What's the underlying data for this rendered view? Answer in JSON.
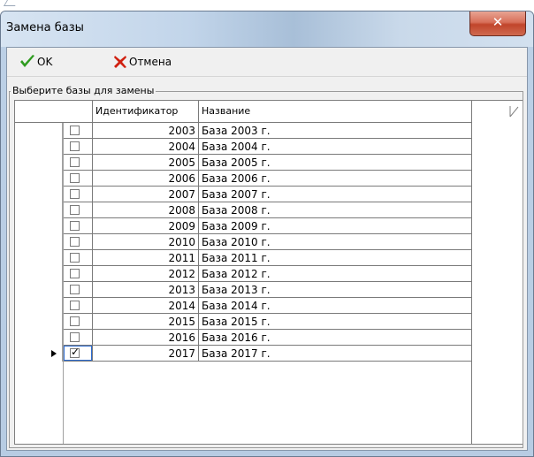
{
  "window": {
    "title": "Замена базы",
    "close_glyph": "✕"
  },
  "toolbar": {
    "ok_label": "OK",
    "cancel_label": "Отмена"
  },
  "group": {
    "label": "Выберите базы для замены"
  },
  "grid": {
    "columns": [
      "Идентификатор",
      "Название"
    ],
    "rows": [
      {
        "id": "2003",
        "name": "База 2003 г.",
        "checked": false
      },
      {
        "id": "2004",
        "name": "База 2004 г.",
        "checked": false
      },
      {
        "id": "2005",
        "name": "База 2005 г.",
        "checked": false
      },
      {
        "id": "2006",
        "name": "База 2006 г.",
        "checked": false
      },
      {
        "id": "2007",
        "name": "База 2007 г.",
        "checked": false
      },
      {
        "id": "2008",
        "name": "База 2008 г.",
        "checked": false
      },
      {
        "id": "2009",
        "name": "База 2009 г.",
        "checked": false
      },
      {
        "id": "2010",
        "name": "База 2010 г.",
        "checked": false
      },
      {
        "id": "2011",
        "name": "База 2011 г.",
        "checked": false
      },
      {
        "id": "2012",
        "name": "База 2012 г.",
        "checked": false
      },
      {
        "id": "2013",
        "name": "База 2013 г.",
        "checked": false
      },
      {
        "id": "2014",
        "name": "База 2014 г.",
        "checked": false
      },
      {
        "id": "2015",
        "name": "База 2015 г.",
        "checked": false
      },
      {
        "id": "2016",
        "name": "База 2016 г.",
        "checked": false
      },
      {
        "id": "2017",
        "name": "База 2017 г.",
        "checked": true,
        "current": true
      }
    ]
  },
  "colors": {
    "ok_check": "#2e9b1f",
    "cancel_x": "#d02010",
    "close_button": "#c9503a"
  },
  "icons": {
    "ok": "check-icon",
    "cancel": "cross-icon",
    "close": "close-icon"
  }
}
